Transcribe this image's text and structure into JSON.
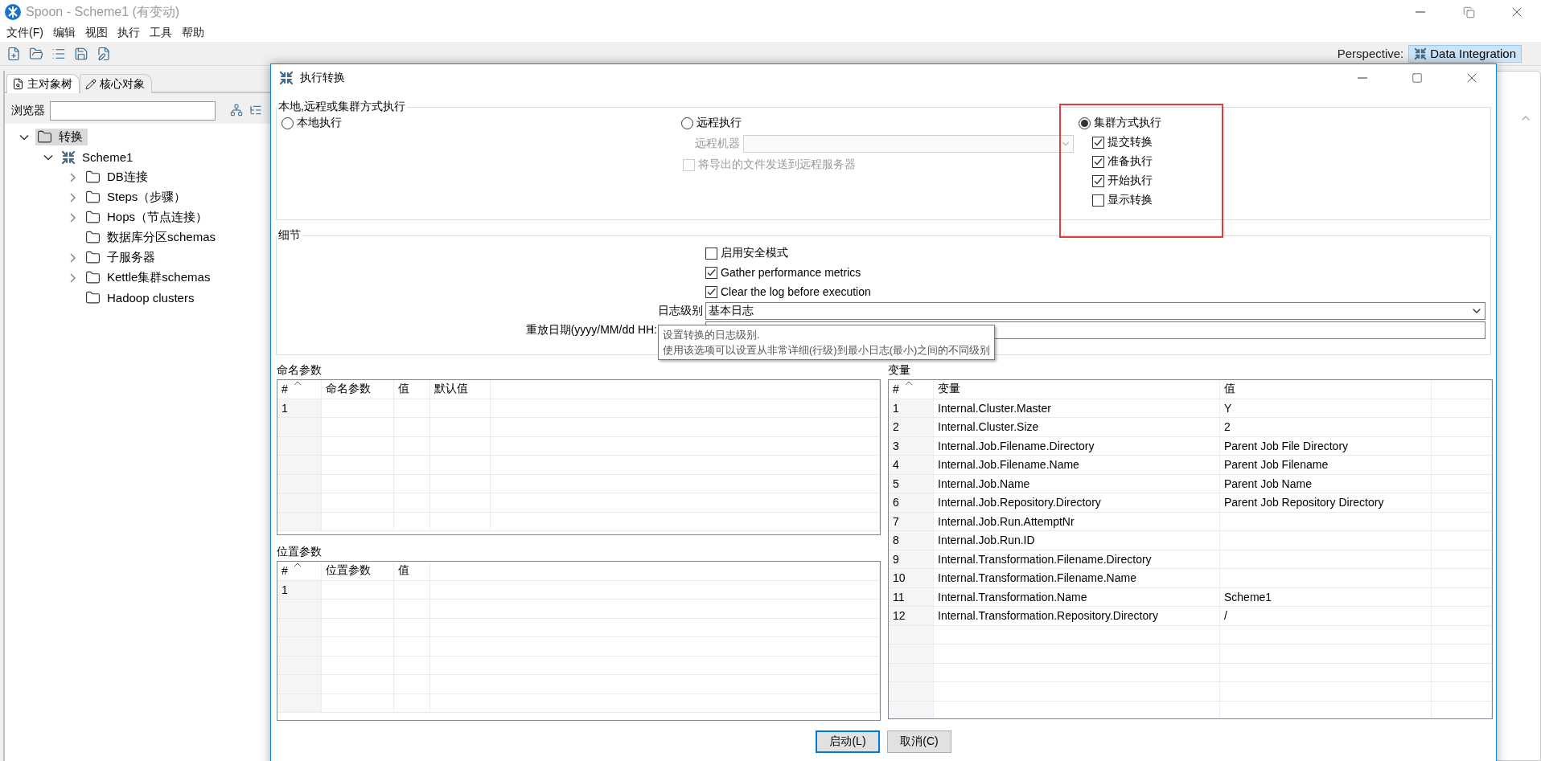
{
  "window": {
    "title": "Spoon - Scheme1 (有变动)"
  },
  "menu": [
    "文件(F)",
    "编辑",
    "视图",
    "执行",
    "工具",
    "帮助"
  ],
  "perspective": {
    "label": "Perspective:",
    "value": "Data Integration"
  },
  "left_panel": {
    "tabs": [
      {
        "label": "主对象树",
        "selected": true
      },
      {
        "label": "核心对象",
        "selected": false
      }
    ],
    "search_label": "浏览器",
    "tree": [
      {
        "label": "转换",
        "kind": "folder",
        "selected": true,
        "expanded": true,
        "children": [
          {
            "label": "Scheme1",
            "kind": "transformation",
            "selected": false,
            "expanded": true,
            "children": [
              {
                "label": "DB连接",
                "kind": "folder",
                "selected": false,
                "expanded": false
              },
              {
                "label": "Steps（步骤）",
                "kind": "folder",
                "selected": false,
                "expanded": false
              },
              {
                "label": "Hops（节点连接）",
                "kind": "folder",
                "selected": false,
                "expanded": false
              },
              {
                "label": "数据库分区schemas",
                "kind": "folder",
                "selected": false
              },
              {
                "label": "子服务器",
                "kind": "folder",
                "selected": false,
                "expanded": false
              },
              {
                "label": "Kettle集群schemas",
                "kind": "folder",
                "selected": false,
                "expanded": false
              },
              {
                "label": "Hadoop clusters",
                "kind": "folder",
                "selected": false
              }
            ]
          }
        ]
      }
    ]
  },
  "dialog": {
    "title": "执行转换",
    "execution": {
      "legend": "本地,远程或集群方式执行",
      "modes": [
        {
          "label": "本地执行",
          "selected": false
        },
        {
          "label": "远程执行",
          "selected": false
        },
        {
          "label": "集群方式执行",
          "selected": true
        }
      ],
      "remote_host": {
        "label": "远程机器",
        "disabled": true
      },
      "send_files": {
        "label": "将导出的文件发送到远程服务器",
        "checked": false,
        "disabled": true
      },
      "cluster_options": [
        {
          "label": "提交转换",
          "checked": true
        },
        {
          "label": "准备执行",
          "checked": true
        },
        {
          "label": "开始执行",
          "checked": true
        },
        {
          "label": "显示转换",
          "checked": false
        }
      ]
    },
    "details": {
      "legend": "细节",
      "options": [
        {
          "label": "启用安全模式",
          "checked": false
        },
        {
          "label": "Gather performance metrics",
          "checked": true
        },
        {
          "label": "Clear the log before execution",
          "checked": true
        }
      ],
      "log_level": {
        "label": "日志级别",
        "value": "基本日志"
      },
      "replay_date": {
        "label": "重放日期(yyyy/MM/dd HH:"
      },
      "tooltip": [
        "设置转换的日志级别.",
        "使用该选项可以设置从非常详细(行级)到最小日志(最小)之间的不同级别"
      ]
    },
    "named_params": {
      "title": "命名参数",
      "columns": [
        "#",
        "命名参数",
        "值",
        "默认值"
      ],
      "rows": [
        [
          "1"
        ]
      ]
    },
    "positional_params": {
      "title": "位置参数",
      "columns": [
        "#",
        "位置参数",
        "值"
      ],
      "rows": [
        [
          "1"
        ]
      ]
    },
    "variables": {
      "title": "变量",
      "columns": [
        "#",
        "变量",
        "值"
      ],
      "rows": [
        [
          "1",
          "Internal.Cluster.Master",
          "Y"
        ],
        [
          "2",
          "Internal.Cluster.Size",
          "2"
        ],
        [
          "3",
          "Internal.Job.Filename.Directory",
          "Parent Job File Directory"
        ],
        [
          "4",
          "Internal.Job.Filename.Name",
          "Parent Job Filename"
        ],
        [
          "5",
          "Internal.Job.Name",
          "Parent Job Name"
        ],
        [
          "6",
          "Internal.Job.Repository.Directory",
          "Parent Job Repository Directory"
        ],
        [
          "7",
          "Internal.Job.Run.AttemptNr"
        ],
        [
          "8",
          "Internal.Job.Run.ID"
        ],
        [
          "9",
          "Internal.Transformation.Filename.Directory"
        ],
        [
          "10",
          "Internal.Transformation.Filename.Name"
        ],
        [
          "11",
          "Internal.Transformation.Name",
          "Scheme1"
        ],
        [
          "12",
          "Internal.Transformation.Repository.Directory",
          "/"
        ]
      ]
    },
    "buttons": [
      {
        "label": "启动(L)",
        "default": true
      },
      {
        "label": "取消(C)",
        "default": false
      }
    ]
  }
}
